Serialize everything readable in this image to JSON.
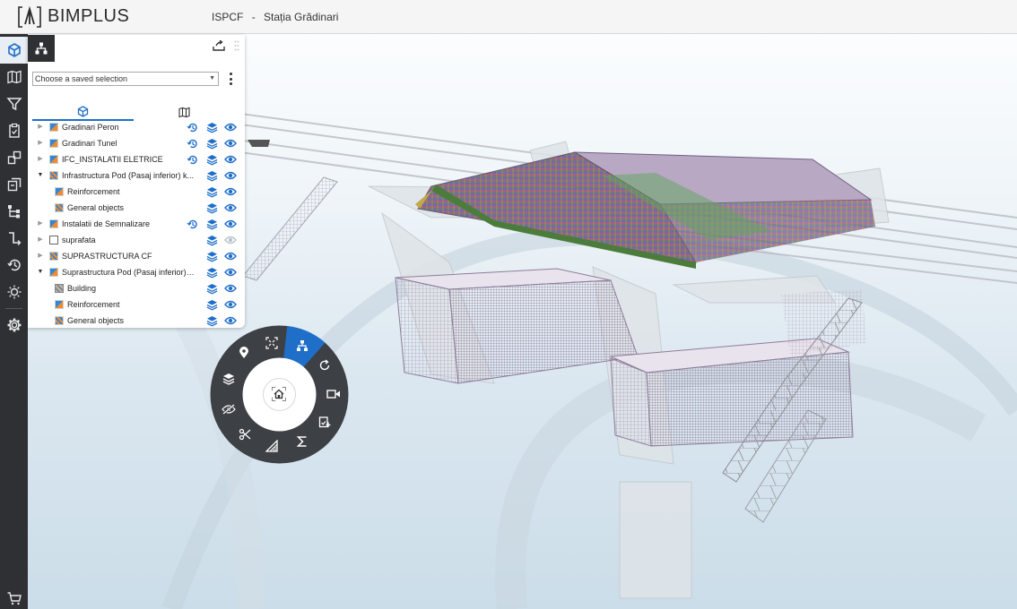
{
  "header": {
    "logo_text": "BIMPLUS",
    "project_code": "ISPCF",
    "separator": "-",
    "project_name": "Stația Grădinari"
  },
  "toolbar": {
    "items": [
      {
        "name": "model-icon",
        "active": true
      },
      {
        "name": "map-icon"
      },
      {
        "name": "filter-icon"
      },
      {
        "name": "clipboard-icon"
      },
      {
        "name": "compare-icon"
      },
      {
        "name": "layers-copy-icon"
      },
      {
        "name": "hierarchy-icon"
      },
      {
        "name": "step-icon"
      },
      {
        "name": "history-icon"
      },
      {
        "name": "sun-icon"
      },
      {
        "name": "settings-icon"
      },
      {
        "name": "cart-icon"
      }
    ]
  },
  "panel": {
    "saved_selection_placeholder": "Choose a saved selection",
    "tree": [
      {
        "label": "Gradinari Peron",
        "level": 0,
        "expand": "collapsed",
        "icon": "colored",
        "history": true,
        "hidden_visibility": false
      },
      {
        "label": "Gradinari Tunel",
        "level": 0,
        "expand": "collapsed",
        "icon": "colored",
        "history": true,
        "hidden_visibility": false
      },
      {
        "label": "IFC_INSTALATII ELETRICE",
        "level": 0,
        "expand": "collapsed",
        "icon": "colored",
        "history": true,
        "hidden_visibility": false
      },
      {
        "label": "Infrastructura Pod (Pasaj inferior) k...",
        "level": 0,
        "expand": "expanded",
        "icon": "colored-checked",
        "history": false,
        "hidden_visibility": false
      },
      {
        "label": "Reinforcement",
        "level": 1,
        "expand": "none",
        "icon": "colored",
        "history": false,
        "hidden_visibility": false
      },
      {
        "label": "General objects",
        "level": 1,
        "expand": "none",
        "icon": "colored-checked",
        "history": false,
        "hidden_visibility": false
      },
      {
        "label": "Instalatii de Semnalizare",
        "level": 0,
        "expand": "collapsed",
        "icon": "colored",
        "history": true,
        "hidden_visibility": false
      },
      {
        "label": "suprafata",
        "level": 0,
        "expand": "collapsed",
        "icon": "empty",
        "history": false,
        "hidden_visibility": true
      },
      {
        "label": "SUPRASTRUCTURA CF",
        "level": 0,
        "expand": "collapsed",
        "icon": "colored-checked",
        "history": false,
        "hidden_visibility": false
      },
      {
        "label": "Suprastructura Pod (Pasaj inferior) k...",
        "level": 0,
        "expand": "expanded",
        "icon": "colored",
        "history": false,
        "hidden_visibility": false
      },
      {
        "label": "Building",
        "level": 1,
        "expand": "none",
        "icon": "gray",
        "history": false,
        "hidden_visibility": false
      },
      {
        "label": "Reinforcement",
        "level": 1,
        "expand": "none",
        "icon": "colored",
        "history": false,
        "hidden_visibility": false
      },
      {
        "label": "General objects",
        "level": 1,
        "expand": "none",
        "icon": "colored-checked",
        "history": false,
        "hidden_visibility": false
      }
    ]
  },
  "radial_menu": {
    "items": [
      "fit-view-icon",
      "hierarchy-icon",
      "rotate-icon",
      "camera-icon",
      "clipboard-add-icon",
      "sum-icon",
      "measure-icon",
      "clip-icon",
      "hide-icon",
      "layers-icon",
      "location-icon"
    ],
    "active": "hierarchy-icon",
    "center": "home-icon"
  },
  "colors": {
    "accent": "#1f6fc9",
    "toolbar_bg": "#2e3033",
    "radial_bg": "#3d4044"
  }
}
